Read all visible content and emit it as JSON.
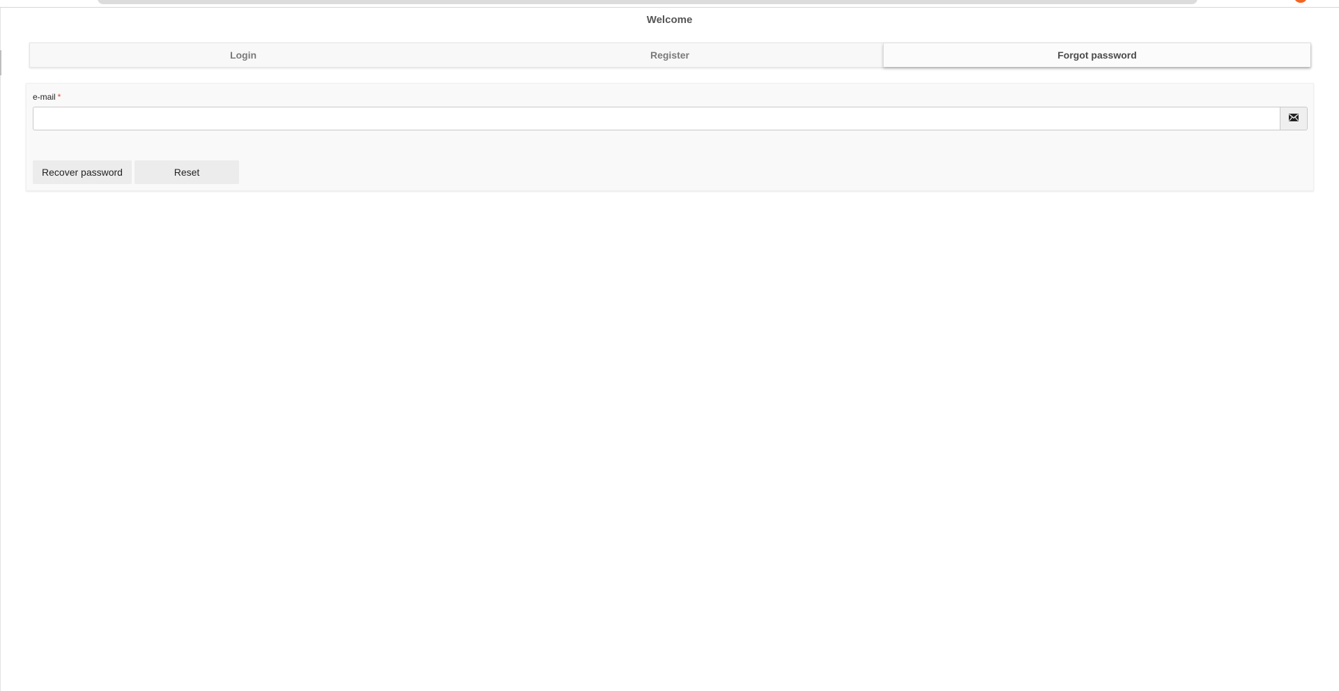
{
  "page": {
    "title": "Welcome"
  },
  "tabs": [
    {
      "label": "Login",
      "active": false
    },
    {
      "label": "Register",
      "active": false
    },
    {
      "label": "Forgot password",
      "active": true
    }
  ],
  "form": {
    "email": {
      "label": "e-mail",
      "required_marker": "*",
      "value": "",
      "placeholder": "",
      "icon": "envelope-icon"
    },
    "buttons": {
      "recover_label": "Recover password",
      "reset_label": "Reset"
    }
  },
  "colors": {
    "accent": "#f26522",
    "required": "#e0442b"
  }
}
